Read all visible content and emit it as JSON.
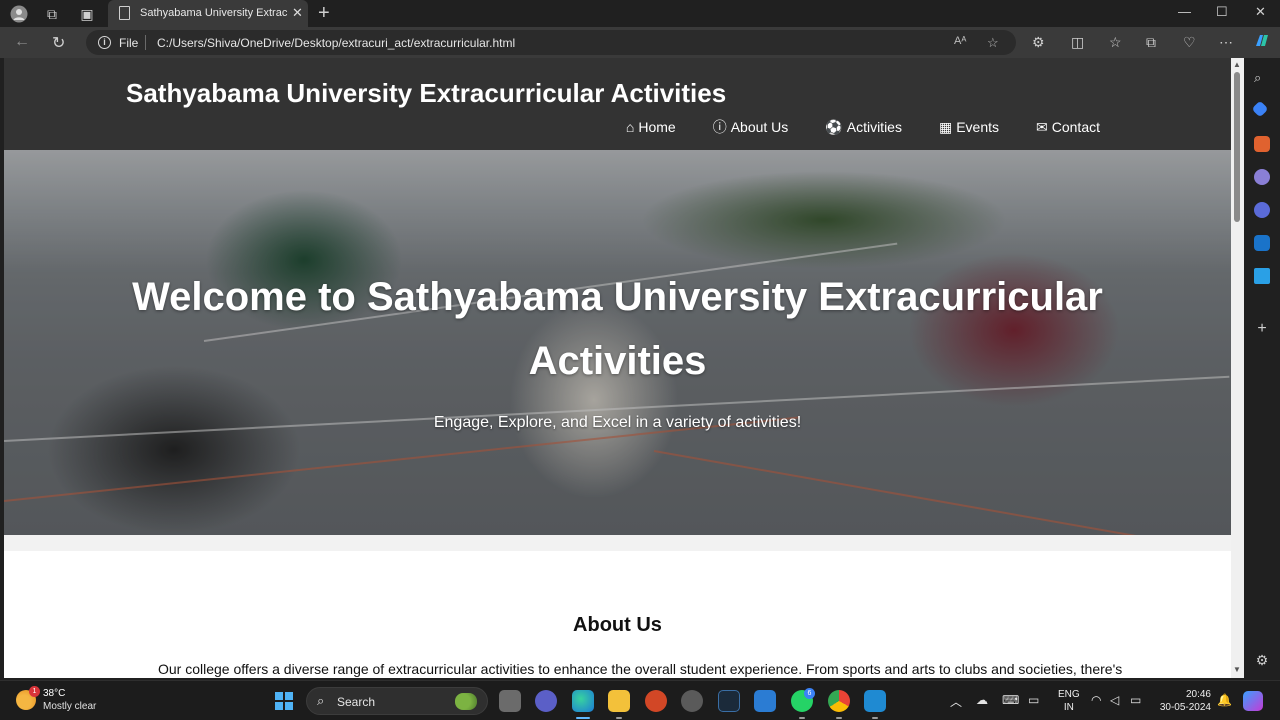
{
  "browser": {
    "tab_title": "Sathyabama University Extracurric",
    "tab_close": "✕",
    "new_tab": "+",
    "file_label": "File",
    "url": "C:/Users/Shiva/OneDrive/Desktop/extracuri_act/extracurricular.html",
    "minimize": "—",
    "maximize": "☐",
    "close": "✕"
  },
  "site": {
    "title": "Sathyabama University Extracurricular Activities",
    "nav": [
      {
        "label": "Home",
        "icon": "home-icon",
        "glyph": "⌂"
      },
      {
        "label": "About Us",
        "icon": "info-icon",
        "glyph": "ⓘ"
      },
      {
        "label": "Activities",
        "icon": "soccer-ball-icon",
        "glyph": "⚽"
      },
      {
        "label": "Events",
        "icon": "calendar-icon",
        "glyph": "▦"
      },
      {
        "label": "Contact",
        "icon": "envelope-icon",
        "glyph": "✉"
      }
    ],
    "hero_title": "Welcome to Sathyabama University Extracurricular Activities",
    "hero_subtitle": "Engage, Explore, and Excel in a variety of activities!",
    "about_title": "About Us",
    "about_text": "Our college offers a diverse range of extracurricular activities to enhance the overall student experience. From sports and arts to clubs and societies, there's"
  },
  "taskbar": {
    "weather_badge": "1",
    "temperature": "38°C",
    "condition": "Mostly clear",
    "search": "Search",
    "whatsapp_badge": "6",
    "lang_line1": "ENG",
    "lang_line2": "IN",
    "time": "20:46",
    "date": "30-05-2024"
  },
  "colors": {
    "header_bg": "#333333",
    "page_bg": "#ffffff",
    "accent": "#60b8ff"
  }
}
